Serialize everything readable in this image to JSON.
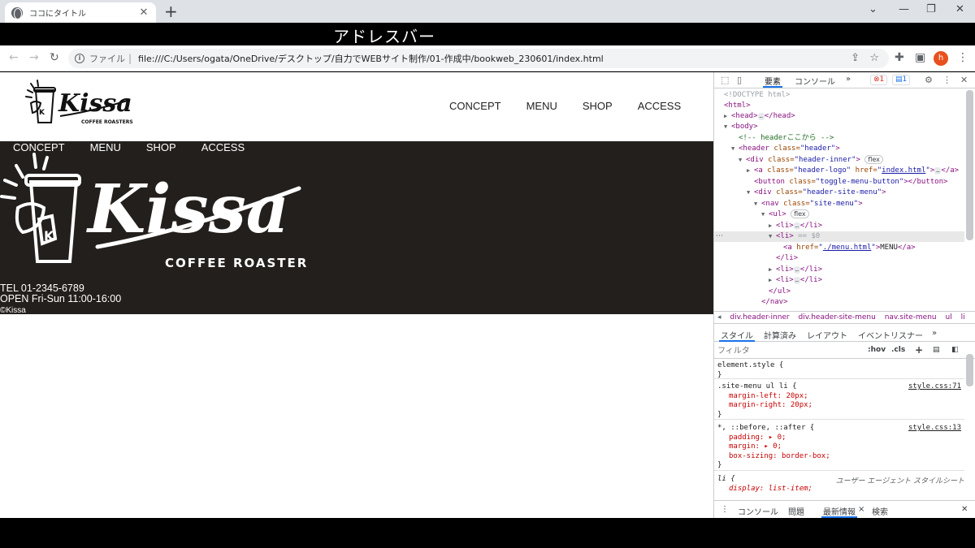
{
  "browser": {
    "tab_title": "ココにタイトル",
    "tab_close": "✕",
    "new_tab": "+",
    "annotation": "アドレスバー",
    "omnibox": {
      "scheme_label": "ファイル",
      "separator": "|",
      "url": "file:///C:/Users/ogata/OneDrive/デスクトップ/自力でWEBサイト制作/01-作成中/bookweb_230601/index.html"
    },
    "profile_initial": "h"
  },
  "site": {
    "header_nav": [
      "CONCEPT",
      "MENU",
      "SHOP",
      "ACCESS"
    ],
    "hero_nav": [
      "CONCEPT",
      "MENU",
      "SHOP",
      "ACCESS"
    ],
    "logo": {
      "word": "Kissa",
      "sub": "COFFEE ROASTERS",
      "cup_letter": "K"
    },
    "tel": "TEL 01-2345-6789",
    "open": "OPEN Fri-Sun 11:00-16:00",
    "copyright": "©Kissa"
  },
  "devtools": {
    "top_tabs": [
      "要素",
      "コンソール",
      "»"
    ],
    "error_count": "1",
    "message_count": "1",
    "dom": {
      "doctype": "<!DOCTYPE html>",
      "html": "<html>",
      "head_open": "<head>",
      "head_close": "</head>",
      "body": "<body>",
      "comment": "<!-- headerここから -->",
      "header_tag": "<header",
      "header_cls": "class=",
      "header_val": "\"header\"",
      "header_end": ">",
      "div_inner_tag": "<div",
      "div_inner_cls": "class=",
      "div_inner_val": "\"header-inner\"",
      "div_inner_end": ">",
      "flex": "flex",
      "a_tag": "<a",
      "a_cls": "class=",
      "a_val": "\"header-logo\"",
      "a_href": "href=",
      "a_href_q1": "\"",
      "a_href_val": "index.html",
      "a_href_q2": "\"",
      "a_end": ">",
      "a_close": "</a>",
      "button_tag": "<button",
      "button_cls": "class=",
      "button_val": "\"toggle-menu-button\"",
      "button_end": "></button>",
      "div_menu_tag": "<div",
      "div_menu_cls": "class=",
      "div_menu_val": "\"header-site-menu\"",
      "div_menu_end": ">",
      "nav_tag": "<nav",
      "nav_cls": "class=",
      "nav_val": "\"site-menu\"",
      "nav_end": ">",
      "ul": "<ul>",
      "li_open": "<li>",
      "li_close": "</li>",
      "li_sel_open": "<li>",
      "sel_marker": "== $0",
      "a2_tag": "<a",
      "a2_href": "href=",
      "a2_q1": "\"",
      "a2_val": "./menu.html",
      "a2_q2": "\"",
      "a2_end": ">",
      "a2_text": "MENU",
      "a2_close": "</a>",
      "li_end": "</li>",
      "ul_close": "</ul>",
      "nav_close": "</nav>",
      "ellipsis": "…"
    },
    "breadcrumbs": [
      "div.header-inner",
      "div.header-site-menu",
      "nav.site-menu",
      "ul",
      "li"
    ],
    "style_tabs": [
      "スタイル",
      "計算済み",
      "レイアウト",
      "イベントリスナー",
      "»"
    ],
    "filter_placeholder": "フィルタ",
    "filter_hov": ":hov",
    "filter_cls": ".cls",
    "filter_plus": "+",
    "rules": {
      "r1_sel": "element.style {",
      "r1_close": "}",
      "r2_sel": ".site-menu ul li {",
      "r2_src": "style.css:71",
      "r2_p1": "margin-left: 20px;",
      "r2_p2": "margin-right: 20px;",
      "r2_close": "}",
      "r3_sel": "*, ::before, ::after {",
      "r3_src": "style.css:13",
      "r3_p1": "padding: ▸ 0;",
      "r3_p2": "margin: ▸ 0;",
      "r3_p3": "box-sizing: border-box;",
      "r3_close": "}",
      "r4_sel": "li {",
      "r4_src": "ユーザー エージェント スタイルシート",
      "r4_p1": "display: list-item;"
    },
    "drawer_tabs": [
      "コンソール",
      "問題",
      "最新情報",
      "検索"
    ],
    "drawer_active_close": "×"
  },
  "colors": {
    "hero_bg": "#231f1c",
    "accent": "#1a73e8",
    "avatar": "#e8501d"
  }
}
